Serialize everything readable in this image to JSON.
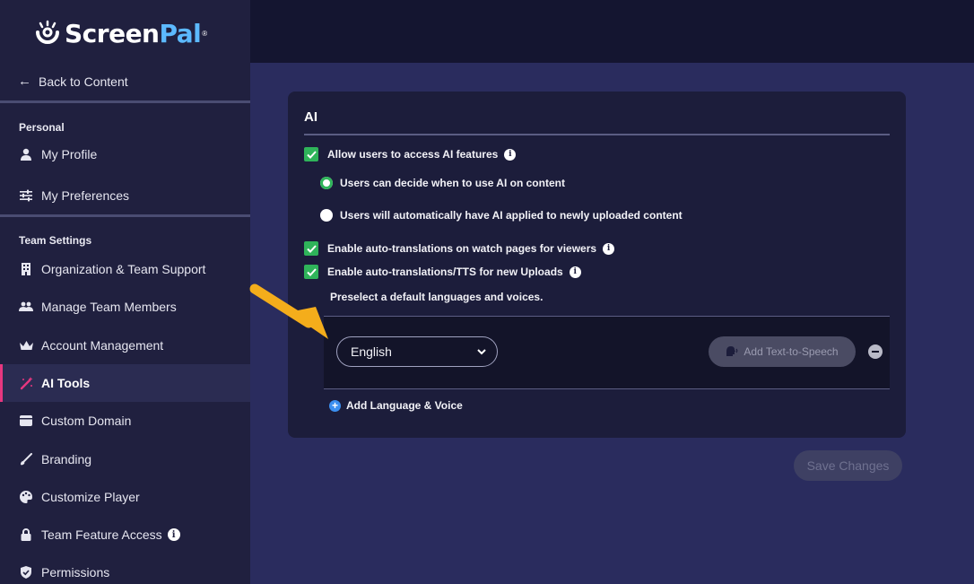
{
  "brand": {
    "name_part1": "Screen",
    "name_part2": "Pal",
    "registered": "®",
    "accent": "#5cb9ff"
  },
  "sidebar": {
    "back_label": "Back to Content",
    "personal_label": "Personal",
    "personal_items": [
      {
        "label": "My Profile",
        "icon": "person-icon"
      },
      {
        "label": "My Preferences",
        "icon": "sliders-icon"
      }
    ],
    "team_label": "Team Settings",
    "team_items": [
      {
        "label": "Organization & Team Support",
        "icon": "building-icon"
      },
      {
        "label": "Manage Team Members",
        "icon": "people-icon"
      },
      {
        "label": "Account Management",
        "icon": "crown-icon"
      },
      {
        "label": "AI Tools",
        "icon": "magic-wand-icon",
        "active": true
      },
      {
        "label": "Custom Domain",
        "icon": "browser-window-icon"
      },
      {
        "label": "Branding",
        "icon": "brush-icon"
      },
      {
        "label": "Customize Player",
        "icon": "palette-icon"
      },
      {
        "label": "Team Feature Access",
        "icon": "lock-icon"
      },
      {
        "label": "Permissions",
        "icon": "shield-icon"
      }
    ],
    "active_color": "#e6377f"
  },
  "ai_card": {
    "title": "AI",
    "allow_ai_label": "Allow users to access AI features",
    "radio_decide_label": "Users can decide when to use AI on content",
    "radio_auto_label": "Users will automatically have AI applied to newly uploaded content",
    "auto_translate_watch_label": "Enable auto-translations on watch pages for viewers",
    "auto_translate_uploads_label": "Enable auto-translations/TTS for new Uploads",
    "preselect_label": "Preselect a default languages and voices.",
    "language_value": "English",
    "tts_button_label": "Add Text-to-Speech",
    "add_language_label": "Add Language & Voice",
    "check_color": "#2fb45a"
  },
  "save_label": "Save Changes",
  "icons": {
    "back": "←",
    "chevron": "⌄",
    "info": "i",
    "plus": "+"
  }
}
